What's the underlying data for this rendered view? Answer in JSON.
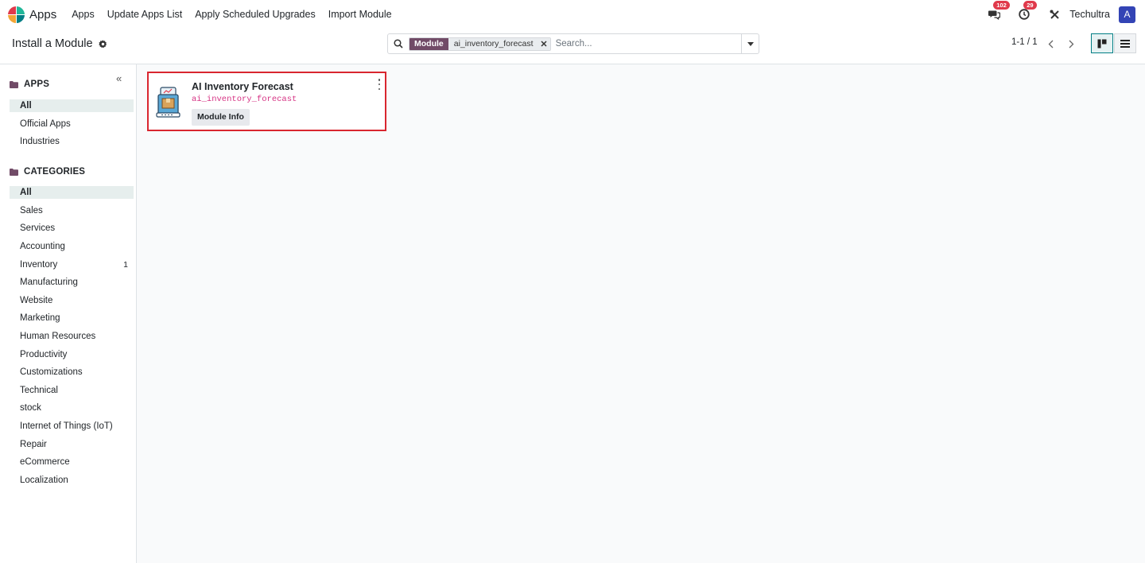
{
  "navbar": {
    "app_title": "Apps",
    "menu": [
      "Apps",
      "Update Apps List",
      "Apply Scheduled Upgrades",
      "Import Module"
    ],
    "messages_count": "102",
    "activities_count": "29",
    "company": "Techultra",
    "avatar_initial": "A"
  },
  "control": {
    "page_title": "Install a Module",
    "facet_label": "Module",
    "facet_value": "ai_inventory_forecast",
    "search_placeholder": "Search...",
    "pager": "1-1 / 1"
  },
  "sidebar": {
    "apps_header": "APPS",
    "apps_items": [
      "All",
      "Official Apps",
      "Industries"
    ],
    "categories_header": "CATEGORIES",
    "categories_items": [
      "All",
      "Sales",
      "Services",
      "Accounting",
      "Inventory",
      "Manufacturing",
      "Website",
      "Marketing",
      "Human Resources",
      "Productivity",
      "Customizations",
      "Technical",
      "stock",
      "Internet of Things (IoT)",
      "Repair",
      "eCommerce",
      "Localization"
    ],
    "inventory_count": "1"
  },
  "card": {
    "name": "AI Inventory Forecast",
    "technical_name": "ai_inventory_forecast",
    "info_button": "Module Info"
  },
  "colors": {
    "brand": "#714b67",
    "highlight_border": "#d9262f",
    "badge": "#e0394b",
    "avatar": "#3344b5"
  }
}
